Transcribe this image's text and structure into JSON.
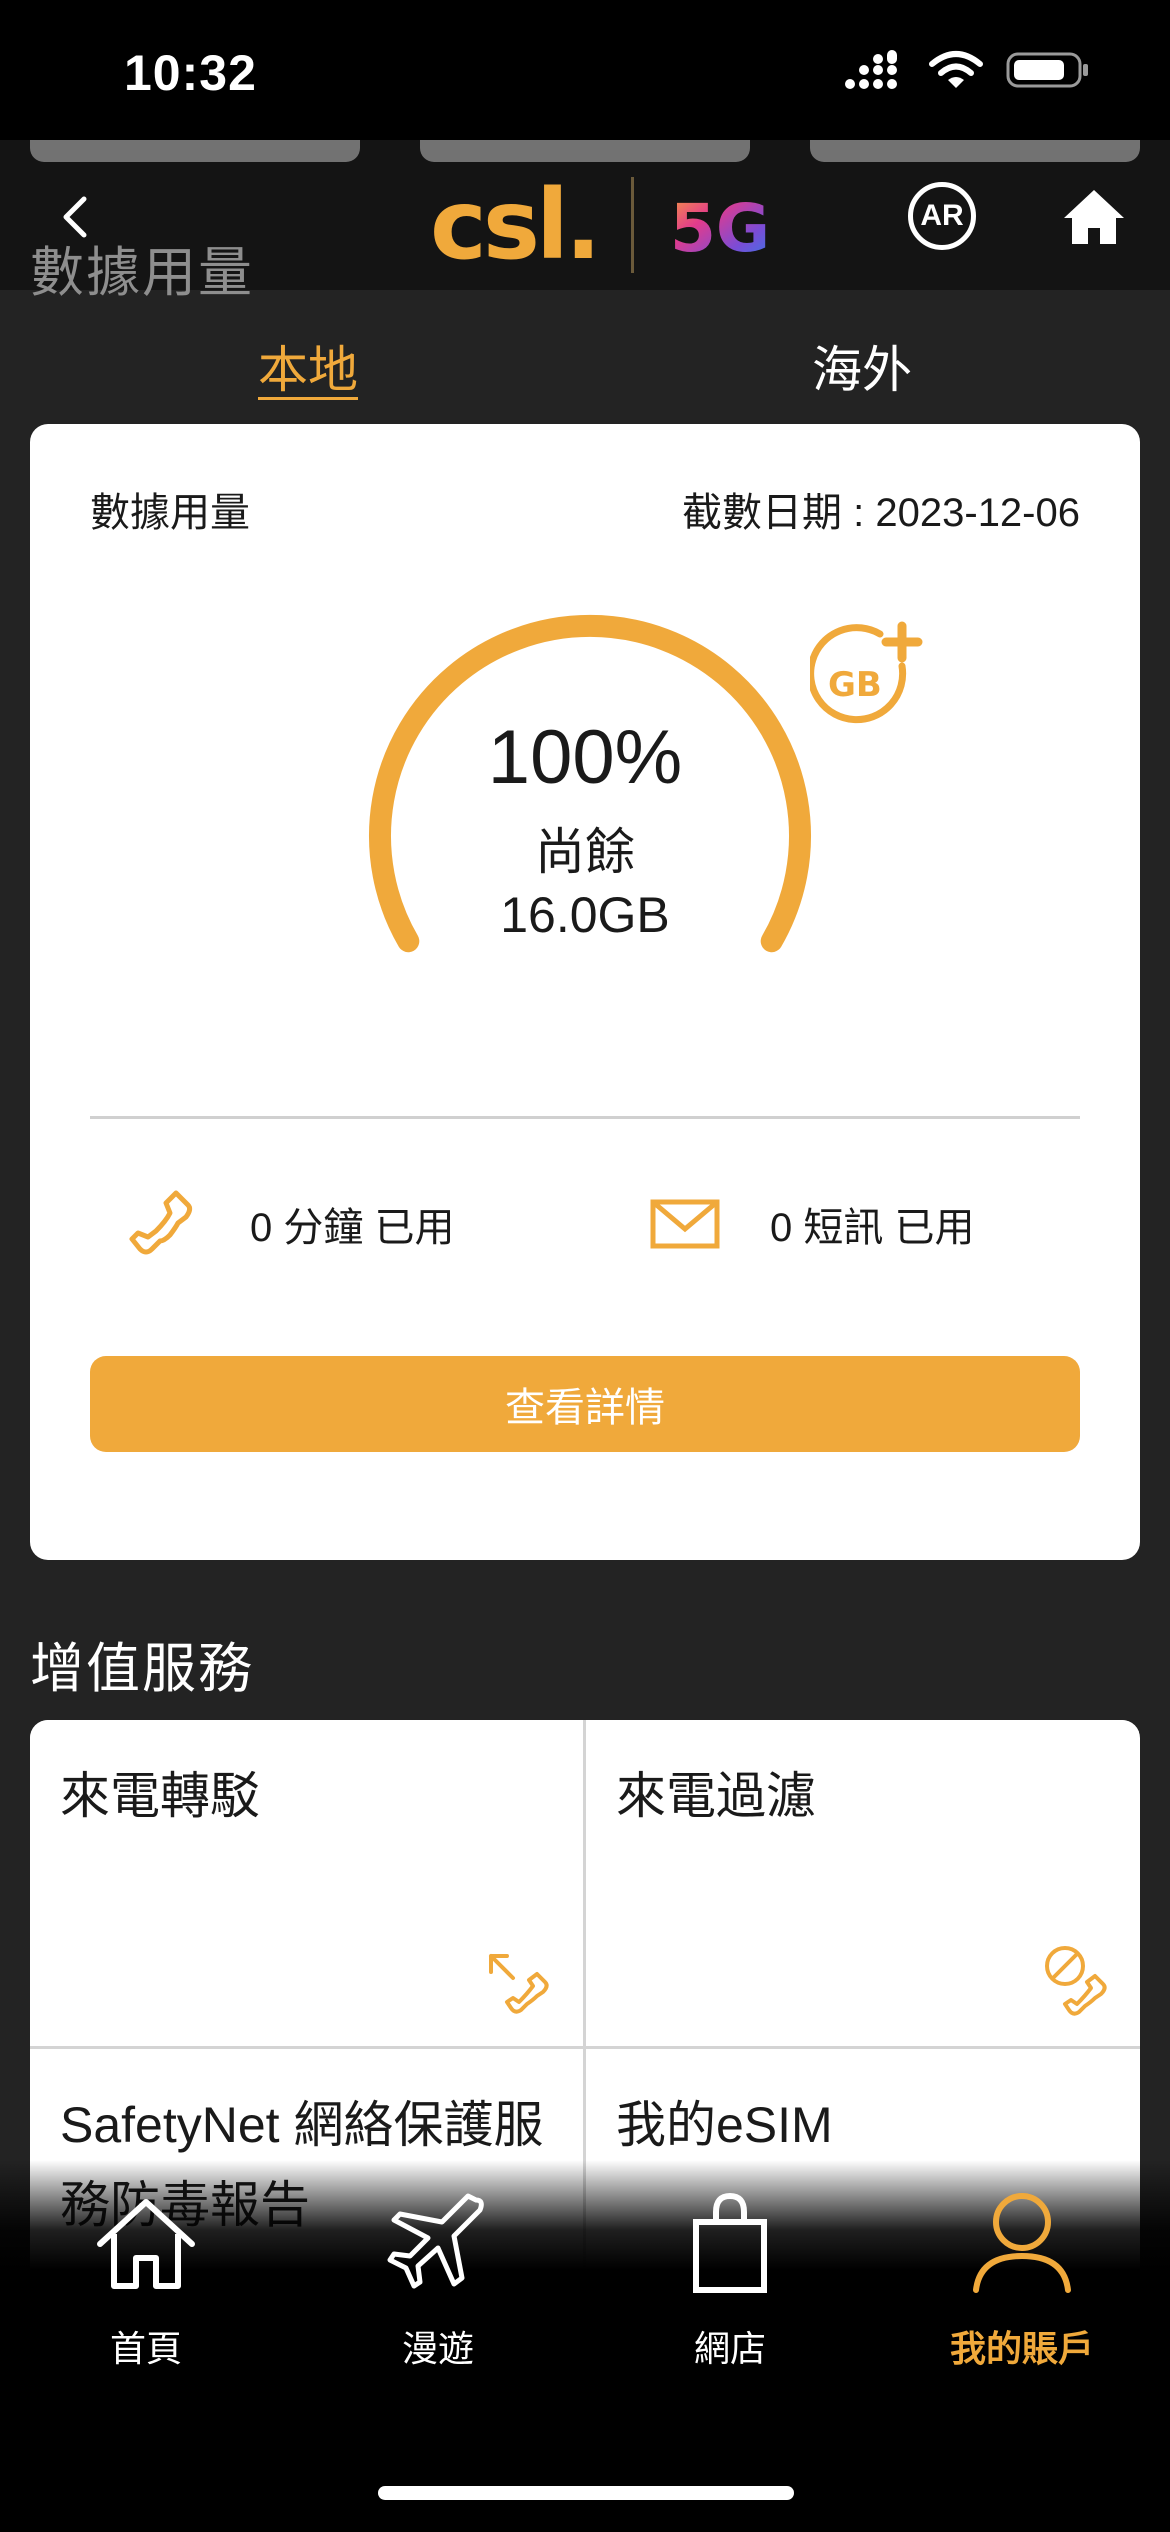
{
  "status_bar": {
    "time": "10:32"
  },
  "header": {
    "title": "數據用量",
    "logo_text": "csl.",
    "logo_5g": "5G",
    "ar_label": "AR"
  },
  "tabs": [
    {
      "label": "本地",
      "active": true
    },
    {
      "label": "海外",
      "active": false
    }
  ],
  "usage_card": {
    "heading": "數據用量",
    "cutoff_date": "截數日期 : 2023-12-06",
    "remaining_percent": "100%",
    "remaining_fraction": 1.0,
    "remaining_label": "尚餘",
    "remaining_amount": "16.0GB",
    "gb_add_text": "GB",
    "minutes_used": "0 分鐘 已用",
    "sms_used": "0 短訊 已用",
    "details_button": "查看詳情"
  },
  "vas": {
    "title": "增值服務",
    "items": [
      {
        "label": "來電轉駁",
        "icon": "call-forward-icon"
      },
      {
        "label": "來電過濾",
        "icon": "call-block-icon"
      },
      {
        "label": "SafetyNet 網絡保護服務防毒報告",
        "icon": ""
      },
      {
        "label": "我的eSIM",
        "icon": ""
      }
    ]
  },
  "bottom_nav": [
    {
      "label": "首頁",
      "icon": "home-icon",
      "active": false
    },
    {
      "label": "漫遊",
      "icon": "airplane-icon",
      "active": false
    },
    {
      "label": "網店",
      "icon": "shopping-bag-icon",
      "active": false
    },
    {
      "label": "我的賬戶",
      "icon": "user-icon",
      "active": true
    }
  ],
  "colors": {
    "accent": "#f0a93b",
    "background": "#232323",
    "header": "#141414",
    "card": "#ffffff"
  }
}
